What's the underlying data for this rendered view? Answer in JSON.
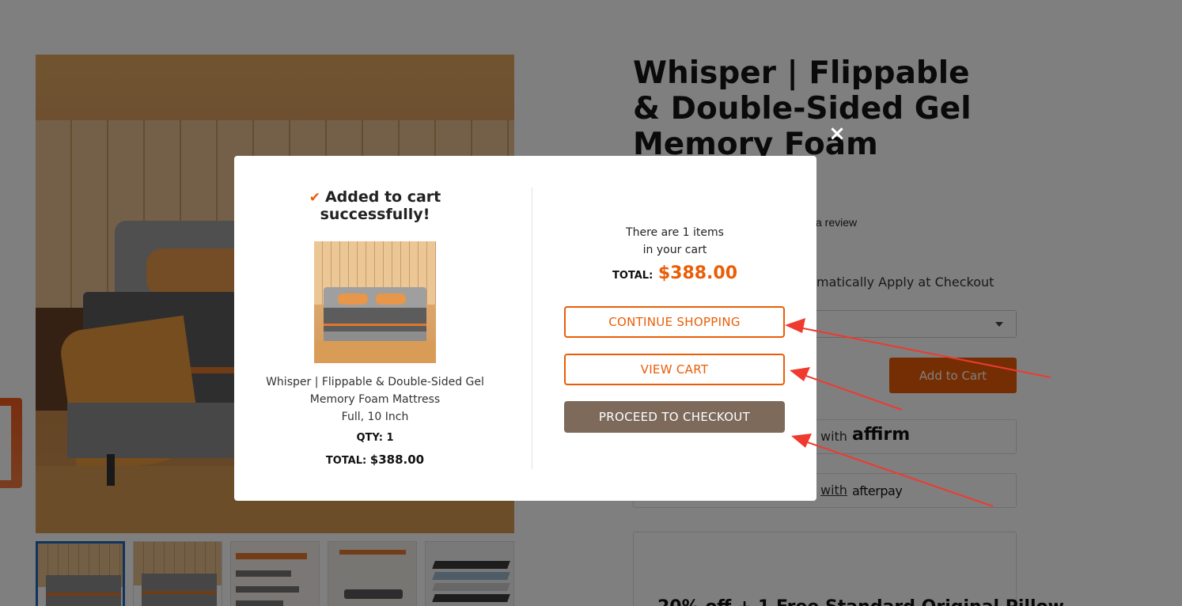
{
  "product": {
    "title": "Whisper | Flippable & Double-Sided Gel Memory Foam",
    "review_link": "a review",
    "promo_text": "matically Apply at Checkout",
    "add_to_cart_label": "Add to Cart",
    "pay_affirm_prefix": "with",
    "pay_affirm_brand": "affirm",
    "pay_afterpay_prefix": "with",
    "pay_afterpay_brand": "afterpay",
    "offer_text": "20% off + 1 Free Standard Original Pillow"
  },
  "modal": {
    "close_icon": "×",
    "added_title": "Added to cart successfully!",
    "check_icon": "✔",
    "item_name_line1": "Whisper | Flippable & Double-Sided Gel",
    "item_name_line2": "Memory Foam Mattress",
    "item_variant": "Full, 10 Inch",
    "qty_label": "QTY:",
    "qty_value": "1",
    "item_total_label": "TOTAL:",
    "item_total_value": "$388.00",
    "cart_count_line1": "There are 1 items",
    "cart_count_line2": "in your cart",
    "cart_total_label": "TOTAL:",
    "cart_total_value": "$388.00",
    "continue_label": "CONTINUE SHOPPING",
    "view_cart_label": "VIEW CART",
    "checkout_label": "PROCEED TO CHECKOUT"
  },
  "colors": {
    "accent": "#ea5d06",
    "checkout_button": "#7d6a5b",
    "annotation_arrow": "#f0392f"
  }
}
